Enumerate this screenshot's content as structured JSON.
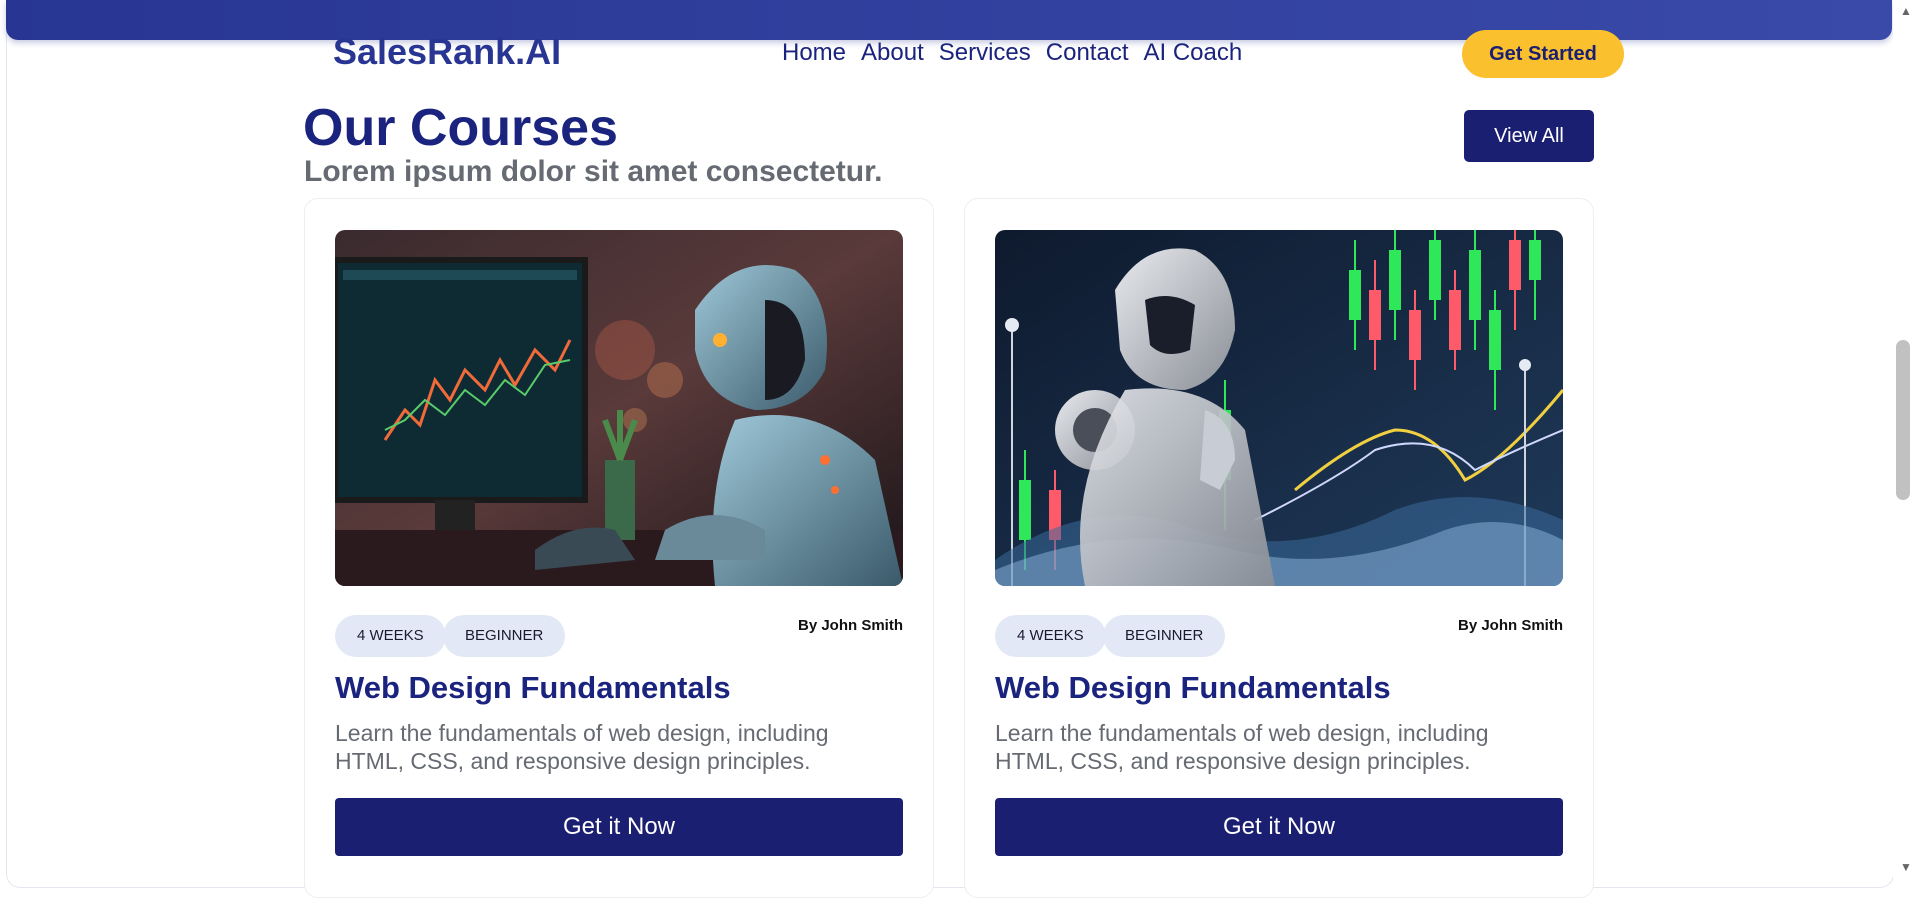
{
  "header": {
    "brand": "SalesRank.AI",
    "nav": [
      "Home",
      "About",
      "Services",
      "Contact",
      "AI Coach"
    ],
    "cta_label": "Get Started",
    "accent_color": "#fbc02d",
    "bar_color": "#283593"
  },
  "section": {
    "title": "Our Courses",
    "subtitle": "Lorem ipsum dolor sit amet consectetur.",
    "view_all_label": "View All"
  },
  "courses": [
    {
      "image_icon": "robot-trading-screen-image",
      "tags": [
        "4 WEEKS",
        "BEGINNER"
      ],
      "author": "By John Smith",
      "title": "Web Design Fundamentals",
      "description": "Learn the fundamentals of web design, including HTML, CSS, and responsive design principles.",
      "button_label": "Get it Now"
    },
    {
      "image_icon": "robot-candlestick-chart-image",
      "tags": [
        "4 WEEKS",
        "BEGINNER"
      ],
      "author": "By John Smith",
      "title": "Web Design Fundamentals",
      "description": "Learn the fundamentals of web design, including HTML, CSS, and responsive design principles.",
      "button_label": "Get it Now"
    }
  ],
  "scrollbar": {
    "up_icon": "scroll-up-arrow-icon",
    "down_icon": "scroll-down-arrow-icon"
  }
}
